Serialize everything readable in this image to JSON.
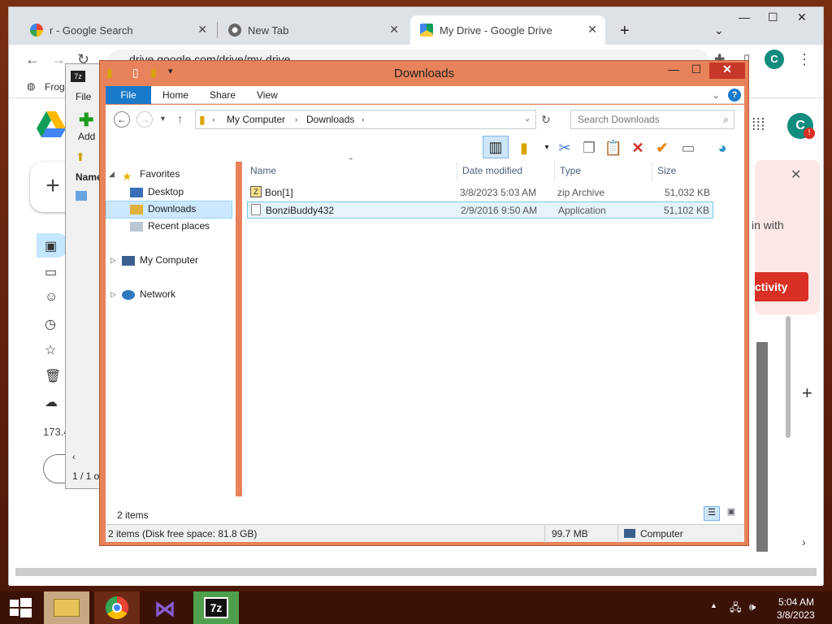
{
  "chrome": {
    "tabs": [
      {
        "title": "r - Google Search",
        "icon": "google-icon"
      },
      {
        "title": "New Tab",
        "icon": "chrome-icon"
      },
      {
        "title": "My Drive - Google Drive",
        "icon": "drive-icon"
      }
    ],
    "url": "drive.google.com/drive/my-drive",
    "bookmark": "Frog",
    "profile_initial": "C",
    "new_button_label": "+",
    "storage_text": "173.4",
    "notif_text": "in with",
    "notif_button": "ctivity",
    "accent": "#1a73e8"
  },
  "sevenzip": {
    "menu_file": "File",
    "add_label": "Add",
    "col_name": "Name",
    "status": "1 / 1 o"
  },
  "explorer": {
    "title": "Downloads",
    "ribbon_tabs": [
      "File",
      "Home",
      "Share",
      "View"
    ],
    "breadcrumb": [
      "My Computer",
      "Downloads"
    ],
    "search_placeholder": "Search Downloads",
    "nav": {
      "favorites": "Favorites",
      "desktop": "Desktop",
      "downloads": "Downloads",
      "recent": "Recent places",
      "mycomputer": "My Computer",
      "network": "Network"
    },
    "columns": [
      "Name",
      "Date modified",
      "Type",
      "Size"
    ],
    "files": [
      {
        "name": "Bon[1]",
        "date": "3/8/2023 5:03 AM",
        "type": "zip Archive",
        "size": "51,032 KB"
      },
      {
        "name": "BonziBuddy432",
        "date": "2/9/2016 9:50 AM",
        "type": "Application",
        "size": "51,102 KB"
      }
    ],
    "item_count": "2 items",
    "status_left": "2 items (Disk free space: 81.8 GB)",
    "status_size": "99.7 MB",
    "status_location": "Computer",
    "titlebar_color": "#e8825a"
  },
  "taskbar": {
    "time": "5:04 AM",
    "date": "3/8/2023"
  }
}
